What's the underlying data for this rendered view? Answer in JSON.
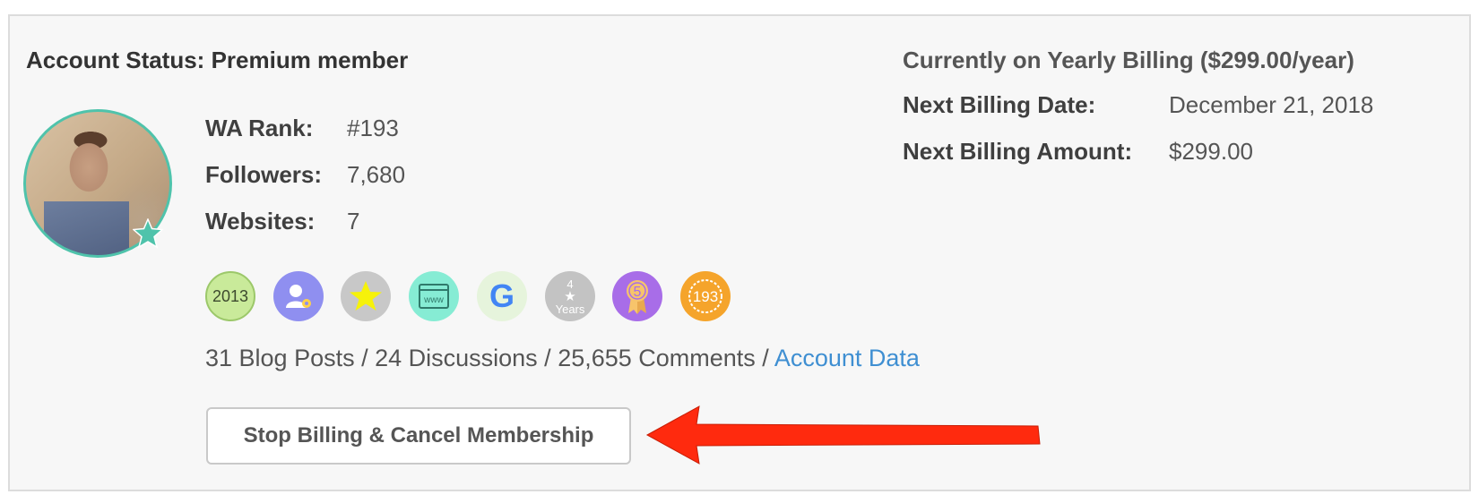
{
  "account": {
    "status_label": "Account Status: Premium member",
    "stats": [
      {
        "label": "WA Rank:",
        "value": "#193"
      },
      {
        "label": "Followers:",
        "value": "7,680"
      },
      {
        "label": "Websites:",
        "value": "7"
      }
    ],
    "badges": [
      {
        "name": "year-2013-badge-icon",
        "text": "2013"
      },
      {
        "name": "user-settings-badge-icon",
        "text": ""
      },
      {
        "name": "star-badge-icon",
        "text": ""
      },
      {
        "name": "website-www-badge-icon",
        "text": "www"
      },
      {
        "name": "google-badge-icon",
        "text": "G"
      },
      {
        "name": "four-years-badge-icon",
        "text_top": "4",
        "text_bottom": "Years"
      },
      {
        "name": "ribbon-5-badge-icon",
        "text": "5"
      },
      {
        "name": "rank-193-badge-icon",
        "text": "193"
      }
    ],
    "activity": {
      "summary": "31 Blog Posts / 24 Discussions / 25,655 Comments / ",
      "link_label": "Account Data"
    },
    "cancel_button_label": "Stop Billing & Cancel Membership"
  },
  "billing": {
    "heading": "Currently on Yearly Billing ($299.00/year)",
    "rows": [
      {
        "label": "Next Billing Date:",
        "value": "December 21, 2018"
      },
      {
        "label": "Next Billing Amount:",
        "value": "$299.00"
      }
    ]
  },
  "colors": {
    "accent_teal": "#4fc3ab",
    "link_blue": "#3f8fd2",
    "arrow_red": "#ff2a0e"
  }
}
